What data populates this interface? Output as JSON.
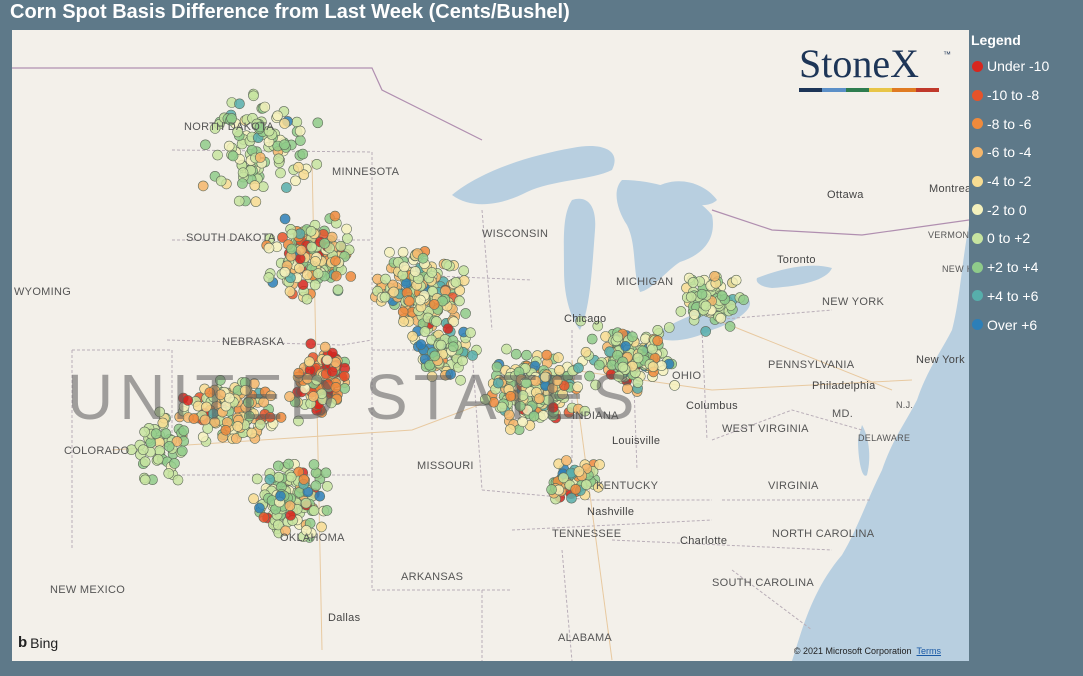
{
  "title": "Corn Spot Basis Difference from Last Week (Cents/Bushel)",
  "logo": {
    "text": "StoneX",
    "tm": "™",
    "bar_colors": [
      "#1d3557",
      "#5b8fc7",
      "#2e7d4f",
      "#e8c547",
      "#e07b22",
      "#c0392b"
    ]
  },
  "legend": {
    "title": "Legend",
    "items": [
      {
        "label": "Under -10",
        "color": "#d7261e"
      },
      {
        "label": "-10 to -8",
        "color": "#e5532a"
      },
      {
        "label": "-8 to -6",
        "color": "#ef8a3c"
      },
      {
        "label": "-6 to -4",
        "color": "#f4b66b"
      },
      {
        "label": "-4 to -2",
        "color": "#f7dc92"
      },
      {
        "label": "-2 to 0",
        "color": "#f4f1bd"
      },
      {
        "label": "0 to +2",
        "color": "#c7e4a0"
      },
      {
        "label": "+2 to +4",
        "color": "#8fcb8a"
      },
      {
        "label": "+4 to +6",
        "color": "#57aeab"
      },
      {
        "label": "Over +6",
        "color": "#2c7fb8"
      }
    ]
  },
  "map_labels": {
    "states": [
      "NORTH DAKOTA",
      "SOUTH DAKOTA",
      "MINNESOTA",
      "WISCONSIN",
      "WYOMING",
      "NEBRASKA",
      "COLORADO",
      "MISSOURI",
      "KENTUCKY",
      "TENNESSEE",
      "OKLAHOMA",
      "ARKANSAS",
      "NEW MEXICO",
      "ALABAMA",
      "NEW YORK",
      "PENNSYLVANIA",
      "WEST VIRGINIA",
      "VIRGINIA",
      "NORTH CAROLINA",
      "SOUTH CAROLINA",
      "MICHIGAN",
      "INDIANA",
      "OHIO",
      "DELAWARE",
      "MD.",
      "N.J.",
      "VERMONT",
      "NEW HAMPSHIRE"
    ],
    "cities": [
      "Chicago",
      "Columbus",
      "Louisville",
      "Nashville",
      "Charlotte",
      "Dallas",
      "Philadelphia",
      "New York",
      "Toronto",
      "Ottawa",
      "Montreal"
    ],
    "country": "UNITED STATES"
  },
  "attribution": {
    "bing": "Bing",
    "copyright": "© 2021 Microsoft Corporation",
    "terms": "Terms"
  },
  "colors": {
    "water": "#b8cfe0",
    "land": "#f3f0ea",
    "background": "#5e7989"
  }
}
